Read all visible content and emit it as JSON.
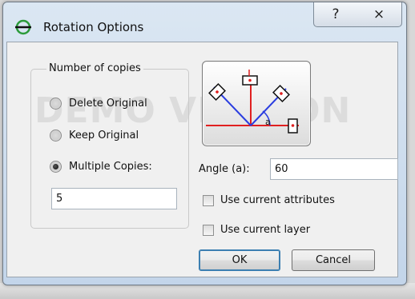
{
  "window": {
    "title": "Rotation Options",
    "help_button": "?",
    "close_button": "⨯"
  },
  "watermark": "DEMO VERSION",
  "copies_group": {
    "label": "Number of copies",
    "options": [
      {
        "label": "Delete Original",
        "selected": false
      },
      {
        "label": "Keep Original",
        "selected": false
      },
      {
        "label": "Multiple Copies:",
        "selected": true
      }
    ],
    "count_value": "5"
  },
  "preview": {
    "angle_symbol": "a"
  },
  "angle": {
    "label": "Angle (a):",
    "value": "60"
  },
  "checkboxes": [
    {
      "label": "Use current attributes",
      "checked": false
    },
    {
      "label": "Use current layer",
      "checked": false
    }
  ],
  "buttons": {
    "ok": "OK",
    "cancel": "Cancel"
  },
  "colors": {
    "accent_green": "#2b9b3a",
    "line_red": "#e02020",
    "line_blue": "#2a3de0"
  }
}
